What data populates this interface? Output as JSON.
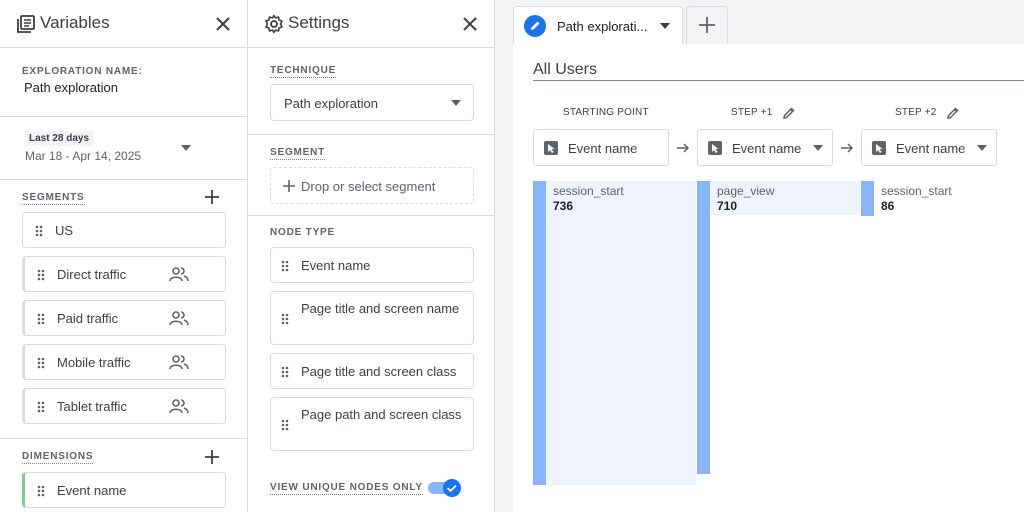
{
  "variables": {
    "title": "Variables",
    "exploration_name_label": "EXPLORATION NAME:",
    "exploration_name": "Path exploration",
    "date_chip": "Last 28 days",
    "date_range": "Mar 18 - Apr 14, 2025",
    "segments_label": "SEGMENTS",
    "segments": [
      {
        "label": "US"
      },
      {
        "label": "Direct traffic"
      },
      {
        "label": "Paid traffic"
      },
      {
        "label": "Mobile traffic"
      },
      {
        "label": "Tablet traffic"
      }
    ],
    "dimensions_label": "DIMENSIONS",
    "dimensions": [
      {
        "label": "Event name"
      }
    ]
  },
  "settings": {
    "title": "Settings",
    "technique_label": "TECHNIQUE",
    "technique_value": "Path exploration",
    "segment_label": "SEGMENT",
    "segment_drop": "Drop or select segment",
    "node_type_label": "NODE TYPE",
    "node_types": [
      {
        "label": "Event name"
      },
      {
        "label": "Page title and screen name"
      },
      {
        "label": "Page title and screen class"
      },
      {
        "label": "Page path and screen class"
      }
    ],
    "unique_nodes_label": "VIEW UNIQUE NODES ONLY",
    "unique_nodes_on": true
  },
  "canvas": {
    "tab_label": "Path explorati...",
    "segment_title": "All Users",
    "steps": [
      {
        "label": "STARTING POINT",
        "dropdown": "Event name",
        "node": "session_start",
        "count": 736
      },
      {
        "label": "STEP +1",
        "dropdown": "Event name",
        "node": "page_view",
        "count": 710
      },
      {
        "label": "STEP +2",
        "dropdown": "Event name",
        "node": "session_start",
        "count": 86
      }
    ]
  },
  "colors": {
    "accent": "#1a73e8",
    "bar": "#8ab4f8",
    "green_marker": "#81c995"
  }
}
